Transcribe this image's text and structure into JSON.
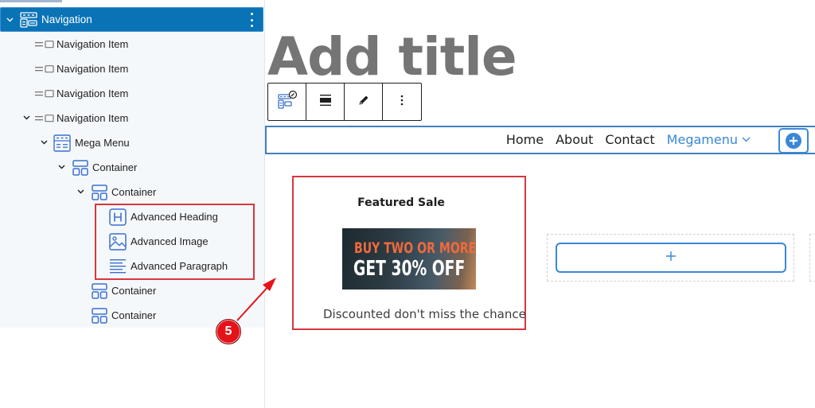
{
  "sidebar": {
    "root": {
      "label": "Navigation",
      "expanded": true,
      "selected": true
    },
    "items": [
      {
        "label": "Navigation Item",
        "level": 1,
        "icon": "navigation-item-icon",
        "expanded": false
      },
      {
        "label": "Navigation Item",
        "level": 1,
        "icon": "navigation-item-icon",
        "expanded": false
      },
      {
        "label": "Navigation Item",
        "level": 1,
        "icon": "navigation-item-icon",
        "expanded": false
      },
      {
        "label": "Navigation Item",
        "level": 1,
        "icon": "navigation-item-icon",
        "expanded": true
      },
      {
        "label": "Mega Menu",
        "level": 2,
        "icon": "mega-menu-icon",
        "expanded": true
      },
      {
        "label": "Container",
        "level": 3,
        "icon": "container-icon",
        "expanded": true
      },
      {
        "label": "Container",
        "level": 4,
        "icon": "container-icon",
        "expanded": true
      },
      {
        "label": "Advanced Heading",
        "level": 5,
        "icon": "heading-icon"
      },
      {
        "label": "Advanced Image",
        "level": 5,
        "icon": "image-icon"
      },
      {
        "label": "Advanced Paragraph",
        "level": 5,
        "icon": "paragraph-icon"
      },
      {
        "label": "Container",
        "level": 4,
        "icon": "container-icon"
      },
      {
        "label": "Container",
        "level": 4,
        "icon": "container-icon"
      }
    ]
  },
  "editor": {
    "title_placeholder": "Add title",
    "toolbar": {
      "buttons": [
        "navigation-block-icon",
        "justify-icon",
        "edit-icon",
        "more-options-icon"
      ]
    },
    "nav": {
      "links": [
        "Home",
        "About",
        "Contact"
      ],
      "megamenu_label": "Megamenu"
    },
    "card": {
      "heading": "Featured Sale",
      "image_line1": "BUY TWO OR MORE",
      "image_line2": "GET 30% OFF",
      "paragraph": "Discounted don't miss the chance"
    },
    "appender_symbol": "+"
  },
  "annotation": {
    "step_number": "5",
    "color": "#e5121a"
  },
  "colors": {
    "accent": "#0a73b6",
    "link": "#3a87d6",
    "highlight": "#d9363e"
  }
}
